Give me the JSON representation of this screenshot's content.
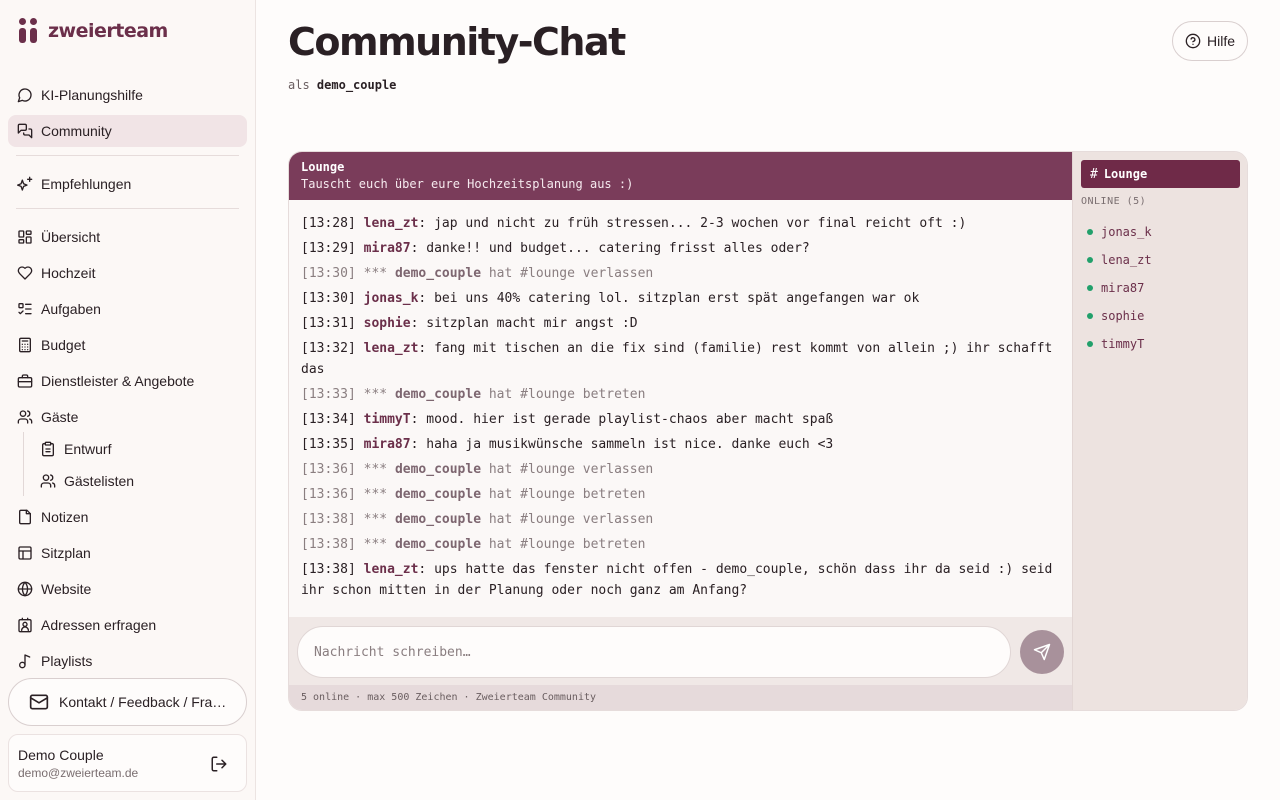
{
  "brand": {
    "name": "zweierteam"
  },
  "nav": {
    "ki": "KI-Planungshilfe",
    "community": "Community",
    "empfehlungen": "Empfehlungen",
    "uebersicht": "Übersicht",
    "hochzeit": "Hochzeit",
    "aufgaben": "Aufgaben",
    "budget": "Budget",
    "dienstleister": "Dienstleister & Angebote",
    "gaeste": "Gäste",
    "entwurf": "Entwurf",
    "gaestelisten": "Gästelisten",
    "notizen": "Notizen",
    "sitzplan": "Sitzplan",
    "website": "Website",
    "adressen": "Adressen erfragen",
    "playlists": "Playlists"
  },
  "contact": {
    "label": "Kontakt / Feedback / Fragen"
  },
  "user": {
    "name": "Demo Couple",
    "email": "demo@zweierteam.de"
  },
  "page": {
    "title": "Community-Chat",
    "as_prefix": "als",
    "as_user": "demo_couple",
    "help": "Hilfe"
  },
  "channel": {
    "name": "Lounge",
    "topic": "Tauscht euch über eure Hochzeitsplanung aus :)"
  },
  "messages": [
    {
      "ts": "[13:28]",
      "nick": "lena_zt",
      "text": ": jap und nicht zu früh stressen... 2-3 wochen vor final reicht oft :)"
    },
    {
      "ts": "[13:29]",
      "nick": "mira87",
      "text": ": danke!! und budget... catering frisst alles oder?"
    },
    {
      "ts": "[13:30]",
      "pre": " *** ",
      "nick": "demo_couple",
      "text": " hat #lounge verlassen"
    },
    {
      "ts": "[13:30]",
      "nick": "jonas_k",
      "text": ": bei uns 40% catering lol. sitzplan erst spät angefangen war ok"
    },
    {
      "ts": "[13:31]",
      "nick": "sophie",
      "text": ": sitzplan macht mir angst :D"
    },
    {
      "ts": "[13:32]",
      "nick": "lena_zt",
      "text": ": fang mit tischen an die fix sind (familie) rest kommt von allein ;) ihr schafft das"
    },
    {
      "ts": "[13:33]",
      "pre": " *** ",
      "nick": "demo_couple",
      "text": " hat #lounge betreten"
    },
    {
      "ts": "[13:34]",
      "nick": "timmyT",
      "text": ": mood. hier ist gerade playlist-chaos aber macht spaß"
    },
    {
      "ts": "[13:35]",
      "nick": "mira87",
      "text": ": haha ja musikwünsche sammeln ist nice. danke euch <3"
    },
    {
      "ts": "[13:36]",
      "pre": " *** ",
      "nick": "demo_couple",
      "text": " hat #lounge verlassen"
    },
    {
      "ts": "[13:36]",
      "pre": " *** ",
      "nick": "demo_couple",
      "text": " hat #lounge betreten"
    },
    {
      "ts": "[13:38]",
      "pre": " *** ",
      "nick": "demo_couple",
      "text": " hat #lounge verlassen"
    },
    {
      "ts": "[13:38]",
      "pre": " *** ",
      "nick": "demo_couple",
      "text": " hat #lounge betreten"
    },
    {
      "ts": "[13:38]",
      "nick": "lena_zt",
      "text": ": ups hatte das fenster nicht offen - demo_couple, schön dass ihr da seid :) seid ihr schon mitten in der Planung oder noch ganz am Anfang?"
    }
  ],
  "composer": {
    "placeholder": "Nachricht schreiben…"
  },
  "footer": {
    "text": "5 online · max 500 Zeichen · Zweierteam Community"
  },
  "side": {
    "channel": "Lounge",
    "online_title": "ONLINE (5)",
    "users": [
      "jonas_k",
      "lena_zt",
      "mira87",
      "sophie",
      "timmyT"
    ]
  }
}
